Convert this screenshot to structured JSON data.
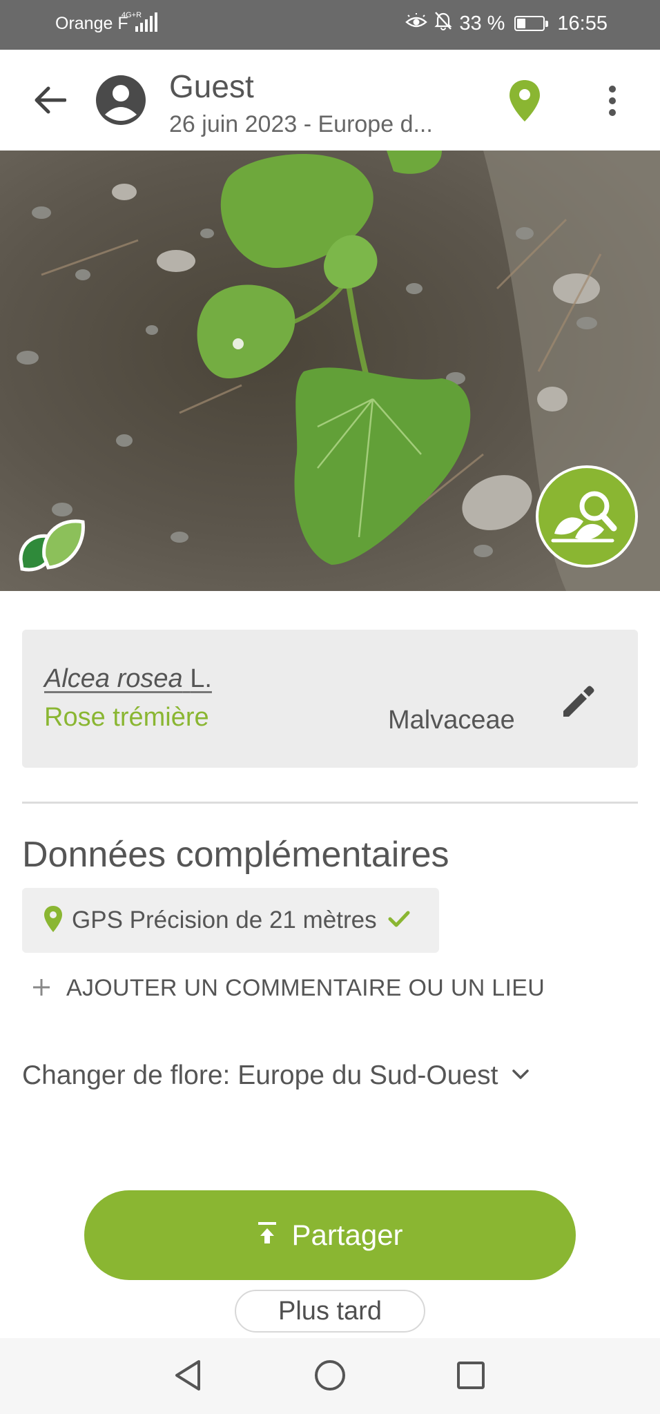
{
  "status_bar": {
    "carrier": "Orange F",
    "network": "4G+R",
    "battery": "33 %",
    "battery_level": 0.33,
    "time": "16:55",
    "icons": [
      "eye-comfort-icon",
      "bell-off-icon",
      "battery-icon",
      "signal-icon"
    ]
  },
  "app_bar": {
    "user_name": "Guest",
    "subtitle": "26 juin 2023 - Europe d...",
    "icons": [
      "back-arrow-icon",
      "account-circle-icon",
      "location-pin-icon",
      "more-vert-icon"
    ],
    "accent_color": "#8ab632"
  },
  "photo": {
    "badge_icon": "leaf-badge-icon",
    "identify_icon": "plant-search-icon"
  },
  "species": {
    "scientific_name": "Alcea rosea",
    "author": "L.",
    "common_name": "Rose trémière",
    "family": "Malvaceae",
    "edit_icon": "pencil-icon"
  },
  "extra": {
    "title": "Données complémentaires",
    "gps_label": "GPS Précision de 21 mètres",
    "gps_ok": true,
    "add_comment_label": "AJOUTER UN COMMENTAIRE OU UN LIEU"
  },
  "flora": {
    "label": "Changer de flore: Europe du Sud-Ouest"
  },
  "actions": {
    "share_label": "Partager",
    "later_label": "Plus tard"
  },
  "nav_bar": {
    "icons": [
      "nav-back-icon",
      "nav-home-icon",
      "nav-recents-icon"
    ]
  }
}
